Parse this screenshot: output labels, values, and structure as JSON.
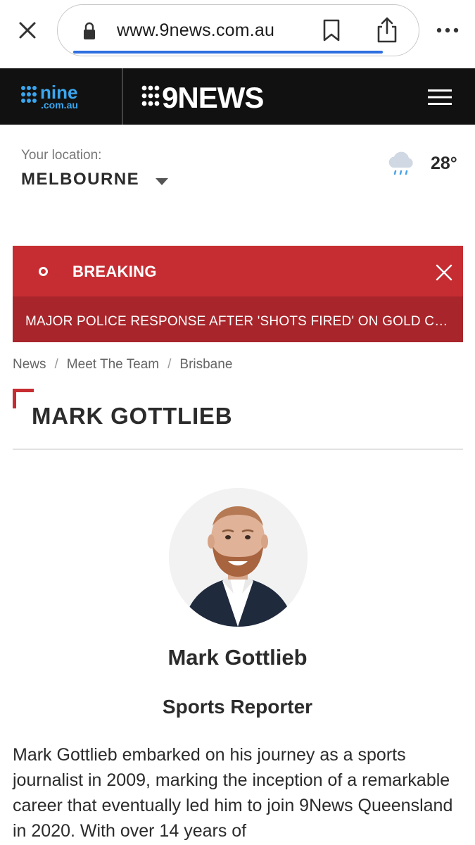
{
  "browser": {
    "url": "www.9news.com.au",
    "icons": [
      "close-icon",
      "lock-icon",
      "bookmark-icon",
      "share-icon",
      "more-icon"
    ]
  },
  "header": {
    "brand_primary": "nine .com.au",
    "brand_secondary": "9NEWS",
    "icons": [
      "menu-icon"
    ],
    "colors": {
      "background": "#111111",
      "nine_blue": "#3aa6ef"
    }
  },
  "location": {
    "label": "Your location:",
    "city": "MELBOURNE",
    "temperature": "28°",
    "weather_icon": "rain-cloud-icon"
  },
  "breaking": {
    "label": "BREAKING",
    "headline": "MAJOR POLICE RESPONSE AFTER 'SHOTS FIRED' ON GOLD COAST",
    "colors": {
      "accent": "#c62d32",
      "dark": "#a8262b"
    }
  },
  "breadcrumb": {
    "items": [
      "News",
      "Meet The Team",
      "Brisbane"
    ],
    "separator": "/"
  },
  "page": {
    "title": "MARK GOTTLIEB"
  },
  "profile": {
    "name": "Mark Gottlieb",
    "role": "Sports Reporter",
    "bio": "Mark Gottlieb embarked on his journey as a sports journalist in 2009, marking the inception of a remarkable career that eventually led him to join 9News Queensland in 2020. With over 14 years of"
  }
}
